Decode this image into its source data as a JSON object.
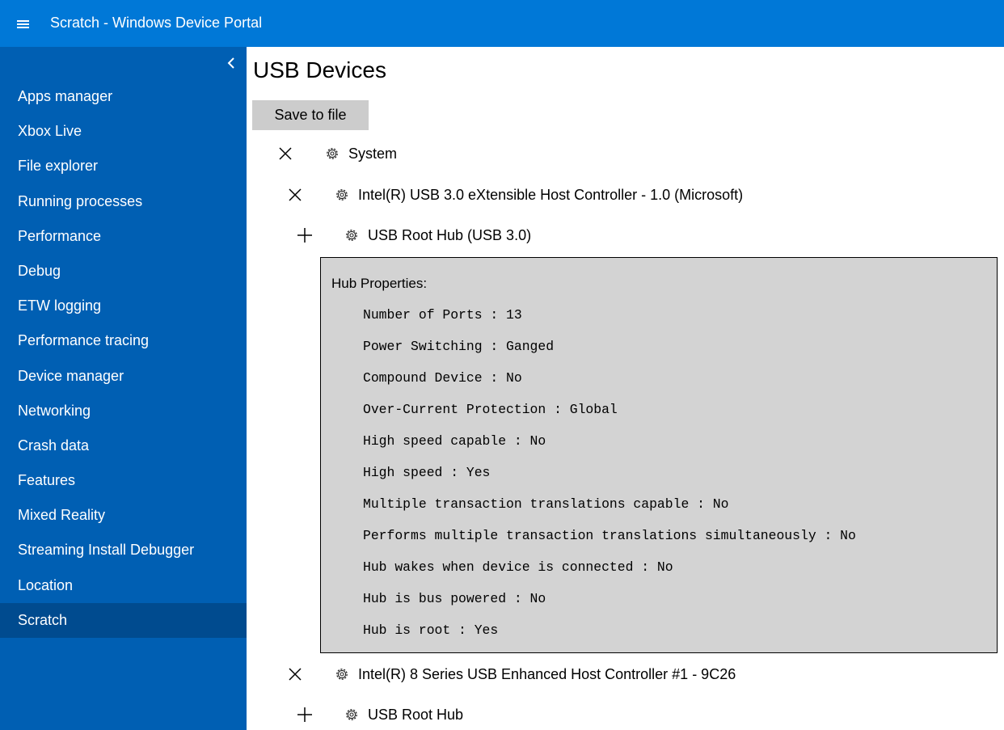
{
  "topbar": {
    "title": "Scratch - Windows Device Portal"
  },
  "sidebar": {
    "items": [
      {
        "label": "Apps manager"
      },
      {
        "label": "Xbox Live"
      },
      {
        "label": "File explorer"
      },
      {
        "label": "Running processes"
      },
      {
        "label": "Performance"
      },
      {
        "label": "Debug"
      },
      {
        "label": "ETW logging"
      },
      {
        "label": "Performance tracing"
      },
      {
        "label": "Device manager"
      },
      {
        "label": "Networking"
      },
      {
        "label": "Crash data"
      },
      {
        "label": "Features"
      },
      {
        "label": "Mixed Reality"
      },
      {
        "label": "Streaming Install Debugger"
      },
      {
        "label": "Location"
      },
      {
        "label": "Scratch"
      }
    ],
    "active_item": "Scratch"
  },
  "main": {
    "title": "USB Devices",
    "save_label": "Save to file",
    "tree": [
      {
        "label": "System",
        "toggle": "collapse"
      },
      {
        "label": "Intel(R) USB 3.0 eXtensible Host Controller - 1.0 (Microsoft)",
        "toggle": "collapse"
      },
      {
        "label": "USB Root Hub (USB 3.0)",
        "toggle": "expand"
      },
      {
        "label": "Intel(R) 8 Series USB Enhanced Host Controller #1 - 9C26",
        "toggle": "collapse"
      },
      {
        "label": "USB Root Hub",
        "toggle": "expand"
      }
    ],
    "hub_properties": {
      "title": "Hub Properties:",
      "lines": [
        "Number of Ports : 13",
        "Power Switching : Ganged",
        "Compound Device : No",
        "Over-Current Protection : Global",
        "High speed capable : No",
        "High speed : Yes",
        "Multiple transaction translations capable : No",
        "Performs multiple transaction translations simultaneously : No",
        "Hub wakes when device is connected : No",
        "Hub is bus powered : No",
        "Hub is root : Yes"
      ]
    }
  },
  "colors": {
    "topbar": "#0078d7",
    "sidebar": "#005fb3",
    "sidebar_active": "#004b8f",
    "button": "#cccccc",
    "properties_panel": "#d3d3d3"
  },
  "icons": {
    "menu": "hamburger-icon",
    "sidebar_collapse": "chevron-left-icon",
    "collapse": "close-x-icon",
    "expand": "plus-icon",
    "device": "gear-icon"
  }
}
